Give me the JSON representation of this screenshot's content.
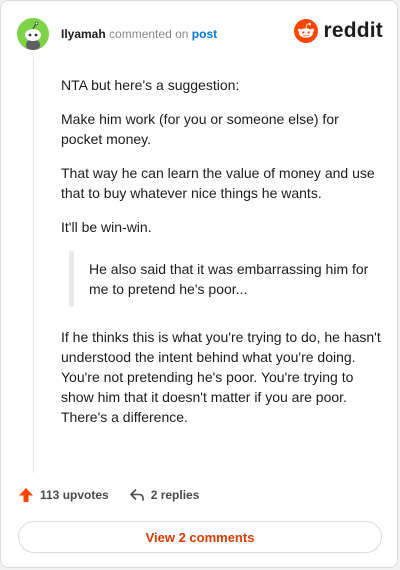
{
  "header": {
    "username": "Ilyamah",
    "commented_on": "commented on",
    "post_link": "post",
    "brand": "reddit"
  },
  "comment": {
    "paragraphs_before": [
      "NTA but here's a suggestion:",
      "Make him work (for you or someone else) for pocket money.",
      "That way he can learn the value of money and use that to buy whatever nice things he wants.",
      "It'll be win-win."
    ],
    "quote": "He also said that it was embarrassing him for me to pretend he's poor...",
    "paragraph_after": "If he thinks this is what you're trying to do, he hasn't understood the intent behind what you're doing. You're not pretending he's poor. You're trying to show him that it doesn't matter if you are poor. There's a difference."
  },
  "actions": {
    "upvotes": "113 upvotes",
    "replies": "2 replies"
  },
  "view_comments_label": "View 2 comments",
  "colors": {
    "upvote": "#ff4500",
    "link": "#0079d3",
    "view_button_text": "#d93a00",
    "avatar_bg": "#7ed349"
  },
  "icons": [
    "snoo-avatar-icon",
    "reddit-logo-icon",
    "upvote-arrow-icon",
    "reply-arrow-icon"
  ]
}
